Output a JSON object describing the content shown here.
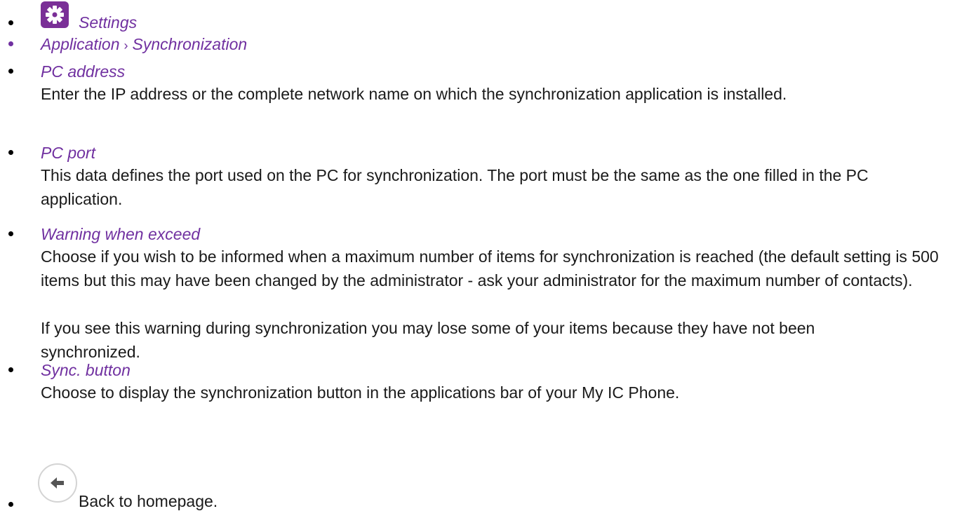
{
  "items": [
    {
      "term": "Settings",
      "icon": "gear-icon",
      "accent": "#7a2f97"
    },
    {
      "path": [
        "Application",
        "Synchronization"
      ],
      "separator": "›"
    },
    {
      "term": "PC address",
      "description": "Enter the IP address or the complete network name on which the synchronization application is installed."
    },
    {
      "term": "PC port",
      "description": "This data defines the port used on the PC for synchronization. The port must be the same as the one filled in the PC application."
    },
    {
      "term": "Warning when exceed",
      "description": "Choose if you wish to be informed when a maximum number of items for synchronization is reached (the default setting is 500 items but this may have been changed by the administrator - ask your administrator for the maximum number of contacts).",
      "description2": "If you see this warning during synchronization you may lose some of your items because they have not been synchronized."
    },
    {
      "term": "Sync. button",
      "description": "Choose to display the synchronization button in the applications bar of your My IC Phone."
    },
    {
      "icon": "back-arrow-icon",
      "text": "Back to homepage."
    }
  ],
  "colors": {
    "term": "#7030a0",
    "text": "#1a1a1a"
  }
}
